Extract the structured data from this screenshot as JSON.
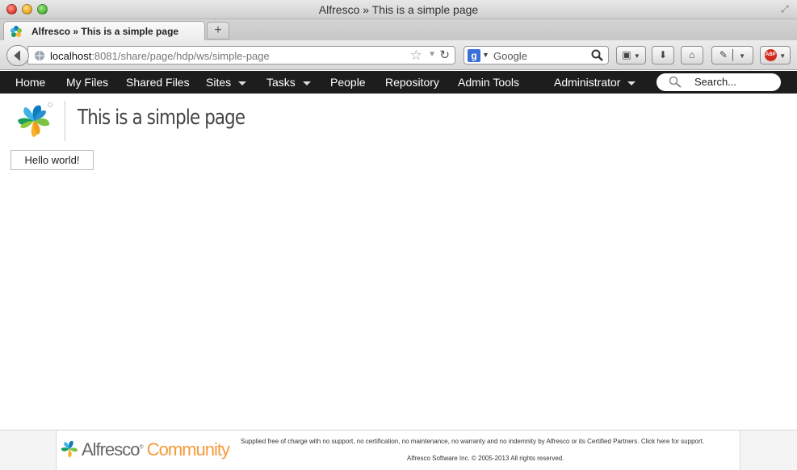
{
  "window": {
    "title": "Alfresco » This is a simple page"
  },
  "tab": {
    "label": "Alfresco » This is a simple page",
    "new_tab_label": "+"
  },
  "urlbar": {
    "host": "localhost",
    "rest": ":8081/share/page/hdp/ws/simple-page"
  },
  "searchbar": {
    "placeholder": "Google"
  },
  "toolbar": {
    "abp_label": "ABP"
  },
  "appnav": {
    "items": [
      {
        "label": "Home",
        "dropdown": false
      },
      {
        "label": "My Files",
        "dropdown": false
      },
      {
        "label": "Shared Files",
        "dropdown": false
      },
      {
        "label": "Sites",
        "dropdown": true
      },
      {
        "label": "Tasks",
        "dropdown": true
      },
      {
        "label": "People",
        "dropdown": false
      },
      {
        "label": "Repository",
        "dropdown": false
      },
      {
        "label": "Admin Tools",
        "dropdown": false
      },
      {
        "label": "Administrator",
        "dropdown": true
      }
    ],
    "search_placeholder": "Search..."
  },
  "page": {
    "title": "This is a simple page",
    "hello": "Hello world!"
  },
  "footer": {
    "brand": "Alfresco",
    "edition": "Community",
    "notice": "Supplied free of charge with no support, no certification, no maintenance, no warranty and no indemnity by Alfresco or its Certified Partners. Click here for support.",
    "copyright": "Alfresco Software Inc. © 2005-2013 All rights reserved."
  },
  "colors": {
    "appbar": "#1d1d1d",
    "community": "#f49a3c"
  }
}
